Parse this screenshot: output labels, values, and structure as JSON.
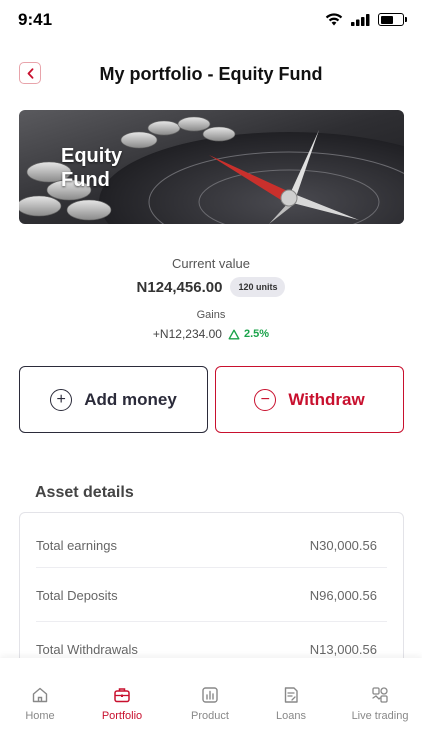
{
  "status_bar": {
    "time": "9:41"
  },
  "header": {
    "back_icon": "chevron-left-icon",
    "title": "My portfolio - Equity Fund"
  },
  "banner": {
    "title": "Equity Fund"
  },
  "summary": {
    "current_value_label": "Current value",
    "current_value": "N124,456.00",
    "units": "120 units",
    "gains_label": "Gains",
    "gains_amount": "+N12,234.00",
    "gains_percent": "2.5%",
    "gains_color": "#1ba34a"
  },
  "actions": {
    "add_money_label": "Add money",
    "withdraw_label": "Withdraw"
  },
  "asset_details": {
    "heading": "Asset details",
    "rows": [
      {
        "label": "Total earnings",
        "value": "N30,000.56"
      },
      {
        "label": "Total Deposits",
        "value": "N96,000.56"
      },
      {
        "label": "Total Withdrawals",
        "value": "N13,000.56"
      }
    ]
  },
  "nav": {
    "items": [
      {
        "label": "Home",
        "icon": "home-icon"
      },
      {
        "label": "Portfolio",
        "icon": "briefcase-icon"
      },
      {
        "label": "Product",
        "icon": "chart-icon"
      },
      {
        "label": "Loans",
        "icon": "document-icon"
      },
      {
        "label": "Live trading",
        "icon": "trading-icon"
      }
    ],
    "active_index": 1
  },
  "colors": {
    "brand": "#c8102e",
    "dark": "#2b2b3a",
    "positive": "#1ba34a"
  }
}
